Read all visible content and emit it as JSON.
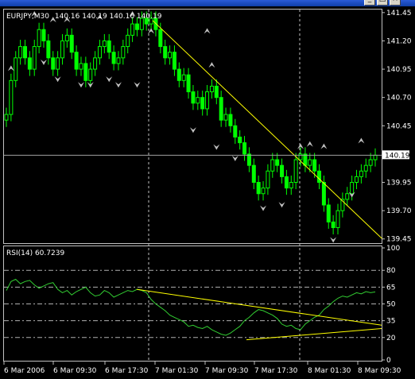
{
  "window": {
    "title_visible": "",
    "controls": [
      "minimize",
      "maximize",
      "close"
    ]
  },
  "colors": {
    "background": "#000000",
    "frame": "#c0c0c0",
    "candle": "#00ff00",
    "trendline": "#ffff00",
    "rsi_line": "#32cd32",
    "grid_label": "#ffffff",
    "fractal_marker": "#c0c0c0",
    "current_price_box": "#ffffff"
  },
  "chart_data": [
    {
      "type": "candlestick",
      "symbol": "EURJPY",
      "timeframe": "M30",
      "header_label": "EURJPY,M30",
      "ohlc_label": "140.16 140.19 140.16 140.19",
      "y_ticks": [
        "141.45",
        "141.20",
        "140.95",
        "140.70",
        "140.45",
        "140.19",
        "139.95",
        "139.70",
        "139.45"
      ],
      "y_range": [
        139.42,
        141.47
      ],
      "current_price": "140.19",
      "current_price_value": 140.19,
      "close_series": [
        140.55,
        140.85,
        141.05,
        141.15,
        141.05,
        140.95,
        141.15,
        141.3,
        141.2,
        141.05,
        140.95,
        141.05,
        141.2,
        141.25,
        141.1,
        140.95,
        141.0,
        140.85,
        140.95,
        141.05,
        141.15,
        141.2,
        141.1,
        141.0,
        141.05,
        141.15,
        141.25,
        141.35,
        141.3,
        141.4,
        141.35,
        141.4,
        141.3,
        141.15,
        141.05,
        141.1,
        140.95,
        140.85,
        140.9,
        140.75,
        140.65,
        140.7,
        140.6,
        140.75,
        140.8,
        140.7,
        140.5,
        140.55,
        140.45,
        140.35,
        140.3,
        140.2,
        140.1,
        139.95,
        139.85,
        139.9,
        140.05,
        140.15,
        140.1,
        140.0,
        139.9,
        139.95,
        140.15,
        140.2,
        140.1,
        140.15,
        140.05,
        139.95,
        139.75,
        139.6,
        139.55,
        139.7,
        139.8,
        139.85,
        139.95,
        140.0,
        140.05,
        140.1,
        140.15,
        140.19
      ],
      "fractal_up_prices": [
        140.92,
        141.4,
        141.35,
        141.35,
        141.37,
        141.4,
        141.25,
        141.25,
        140.95,
        140.23,
        140.25,
        140.23,
        140.28
      ],
      "fractal_down_prices": [
        141.05,
        140.9,
        140.85,
        140.85,
        140.9,
        140.85,
        140.85,
        140.45,
        140.3,
        140.2,
        139.76,
        139.79,
        139.48,
        139.88
      ],
      "trendlines": [
        {
          "from": [
            192,
            141.38
          ],
          "to": [
            481,
            139.45
          ]
        }
      ]
    },
    {
      "type": "line",
      "indicator": "RSI",
      "period": 14,
      "header_label": "RSI(14) 60.7239",
      "y_ticks": [
        "100",
        "80",
        "65",
        "50",
        "35",
        "20",
        "0"
      ],
      "y_range": [
        0,
        100
      ],
      "levels": [
        80,
        65,
        50,
        35,
        20
      ],
      "values": [
        62,
        70,
        72,
        68,
        70,
        71,
        67,
        64,
        66,
        68,
        69,
        63,
        60,
        62,
        58,
        61,
        63,
        65,
        60,
        57,
        58,
        62,
        60,
        56,
        58,
        60,
        62,
        61,
        63,
        62,
        60,
        54,
        50,
        47,
        44,
        40,
        38,
        36,
        34,
        30,
        31,
        29,
        28,
        30,
        27,
        25,
        23,
        22,
        24,
        27,
        30,
        35,
        38,
        42,
        45,
        44,
        42,
        40,
        37,
        32,
        30,
        31,
        28,
        27,
        32,
        35,
        38,
        40,
        45,
        48,
        52,
        55,
        57,
        56,
        58,
        60,
        59,
        61,
        60,
        60.7239
      ],
      "trendlines": [
        {
          "from": [
            172,
            63
          ],
          "to": [
            480,
            31
          ]
        },
        {
          "from": [
            310,
            18
          ],
          "to": [
            480,
            28
          ]
        }
      ]
    }
  ],
  "x_axis": {
    "tick_labels": [
      "6 Mar 2006",
      "6 Mar 09:30",
      "6 Mar 17:30",
      "7 Mar 01:30",
      "7 Mar 09:30",
      "7 Mar 17:30",
      "8 Mar 01:30",
      "8 Mar 09:30"
    ],
    "period_separators": [
      "7 Mar",
      "8 Mar"
    ]
  }
}
